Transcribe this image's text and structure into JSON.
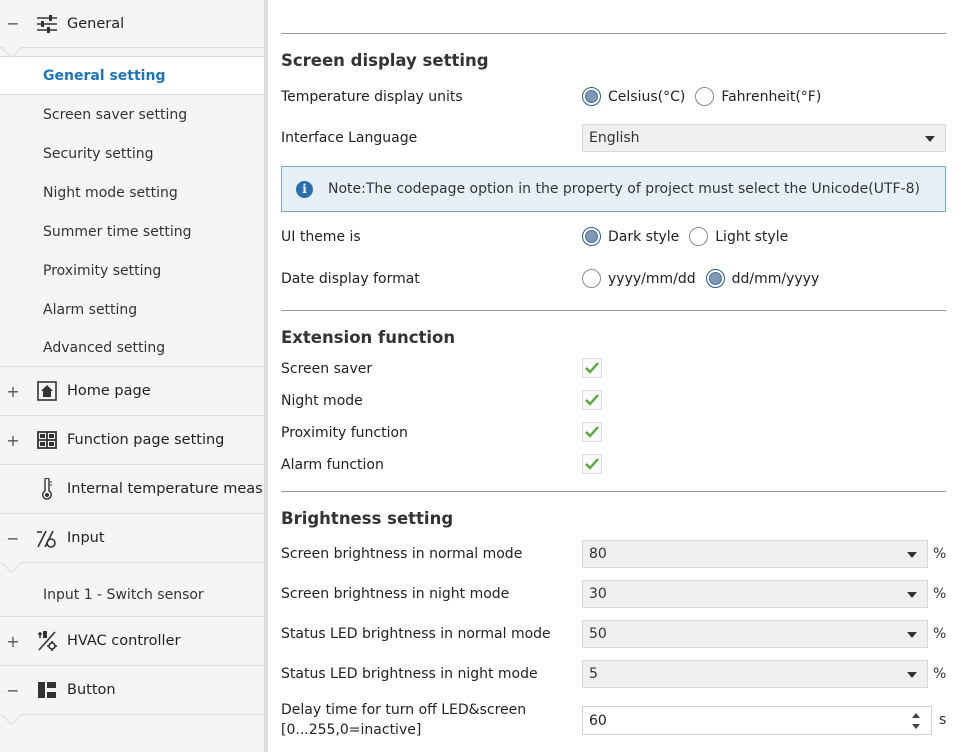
{
  "sidebar": {
    "general": {
      "toggle": "−",
      "label": "General",
      "icon": "sliders-icon"
    },
    "general_items": [
      "General setting",
      "Screen saver setting",
      "Security setting",
      "Night mode setting",
      "Summer time setting",
      "Proximity setting",
      "Alarm setting",
      "Advanced setting"
    ],
    "home": {
      "toggle": "+",
      "label": "Home page",
      "icon": "home-icon"
    },
    "function": {
      "toggle": "+",
      "label": "Function page setting",
      "icon": "grid-icon"
    },
    "internal_temp": {
      "label": "Internal temperature meas...",
      "icon": "thermometer-icon"
    },
    "input": {
      "toggle": "−",
      "label": "Input",
      "icon": "switch-sensor-icon"
    },
    "input_items": [
      "Input 1 - Switch sensor"
    ],
    "hvac": {
      "toggle": "+",
      "label": "HVAC controller",
      "icon": "hvac-icon"
    },
    "button": {
      "toggle": "−",
      "label": "Button",
      "icon": "button-layout-icon"
    }
  },
  "main": {
    "screen_display": {
      "title": "Screen display setting",
      "temp_units": {
        "label": "Temperature display units",
        "opt1": "Celsius(°C)",
        "opt2": "Fahrenheit(°F)",
        "selected": 1
      },
      "language": {
        "label": "Interface Language",
        "value": "English"
      },
      "note": "Note:The codepage option in the property of project must select the Unicode(UTF-8)",
      "ui_theme": {
        "label": "UI theme is",
        "opt1": "Dark style",
        "opt2": "Light style",
        "selected": 1
      },
      "date_format": {
        "label": "Date display format",
        "opt1": "yyyy/mm/dd",
        "opt2": "dd/mm/yyyy",
        "selected": 2
      }
    },
    "extension": {
      "title": "Extension function",
      "items": [
        {
          "label": "Screen saver",
          "checked": true
        },
        {
          "label": "Night mode",
          "checked": true
        },
        {
          "label": "Proximity function",
          "checked": true
        },
        {
          "label": "Alarm function",
          "checked": true
        }
      ]
    },
    "brightness": {
      "title": "Brightness setting",
      "normal": {
        "label": "Screen brightness in normal mode",
        "value": "80",
        "unit": "%"
      },
      "night": {
        "label": "Screen brightness in night mode",
        "value": "30",
        "unit": "%"
      },
      "led_normal": {
        "label": "Status LED brightness in normal mode",
        "value": "50",
        "unit": "%"
      },
      "led_night": {
        "label": "Status LED brightness in night mode",
        "value": "5",
        "unit": "%"
      },
      "delay": {
        "label1": "Delay time for turn off LED&screen",
        "label2": "[0...255,0=inactive]",
        "value": "60",
        "unit": "s"
      }
    }
  },
  "colors": {
    "accent": "#1b75bb",
    "note_bg": "#e6f0f8",
    "check": "#5aa83c"
  }
}
